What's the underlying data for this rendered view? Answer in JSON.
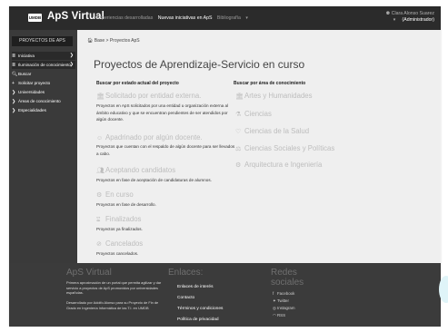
{
  "nav": {
    "logo_text": "UMDB",
    "brand": "ApS Virtual",
    "links": [
      "Experiencias desarrolladas",
      "Nuevas iniciativas en ApS",
      "Bibliografía"
    ],
    "dropdown_caret": "▾",
    "user_name": "Clara Alonso Suarez",
    "user_role": "(Administrador)",
    "user_caret": "▾"
  },
  "sidebar": {
    "title": "PROYECTOS DE APS",
    "items": [
      {
        "icon": "≣",
        "label": "Iniciativa",
        "chevron": "❯"
      },
      {
        "icon": "≣",
        "label": "Iluminación de conocimiento",
        "chevron": "❯"
      },
      {
        "icon": "🔍︎",
        "label": "Buscar",
        "chevron": ""
      },
      {
        "icon": "+",
        "label": "Solicitar proyecto",
        "chevron": ""
      },
      {
        "icon": "❯",
        "label": "Universidades",
        "chevron": ""
      },
      {
        "icon": "❯",
        "label": "Áreas de conocimiento",
        "chevron": ""
      },
      {
        "icon": "❯",
        "label": "Especialidades",
        "chevron": ""
      }
    ]
  },
  "main": {
    "breadcrumb": "🏠︎ Base > Proyectos ApS",
    "title": "Proyectos de Aprendizaje-Servicio en curso",
    "left_header": "Buscar por estado actual del proyecto",
    "right_header": "Buscar por área de conocimiento",
    "states": [
      {
        "icon": "🏛︎",
        "label": "Solicitado por entidad externa.",
        "desc": "Proyectos en ApS solicitados por una entidad u organización externa al ámbito educativo y que se encuentran pendientes de ser atendidos por algún docente."
      },
      {
        "icon": "☺︎",
        "label": "Apadrinado por algún docente.",
        "desc": "Proyectos que cuentan con el respaldo de algún docente para ser llevados a cabo."
      },
      {
        "icon": "👥︎",
        "label": "Aceptando candidatos",
        "desc": "Proyectos en fase de aceptación de candidaturas de alumnos."
      },
      {
        "icon": "⚙︎",
        "label": "En curso",
        "desc": "Proyectos en fase de desarrollo."
      },
      {
        "icon": "⌛︎",
        "label": "Finalizados",
        "desc": "Proyectos ya finalizados."
      },
      {
        "icon": "⊘",
        "label": "Cancelados",
        "desc": "Proyectos cancelados."
      }
    ],
    "areas": [
      {
        "icon": "🏛︎",
        "label": "Artes y Humanidades"
      },
      {
        "icon": "⚗︎",
        "label": "Ciencias"
      },
      {
        "icon": "♡︎",
        "label": "Ciencias de la Salud"
      },
      {
        "icon": "⚖︎",
        "label": "Ciencias Sociales y Políticas"
      },
      {
        "icon": "⚙︎",
        "label": "Arquitectura e Ingeniería"
      }
    ]
  },
  "footer": {
    "col1_title": "ApS Virtual",
    "col1_text1": "Primera aproximación de un portal que permita agilizar y dar servicio a proyectos de ApS promovidos por universidades españolas.",
    "col1_text2": "Desarrollado por Adolfo Alonso para su Proyecto de Fin de Grado en Ingeniería Informática de las T.I. en UMDB",
    "col2_title": "Enlaces:",
    "links": [
      "Enlaces de interés",
      "Contacto",
      "Términos y condiciones",
      "Política de privacidad"
    ],
    "col3_title": "Redes sociales",
    "social": [
      {
        "icon": "f",
        "label": "Facebook"
      },
      {
        "icon": "✦",
        "label": "Twitter"
      },
      {
        "icon": "◎",
        "label": "Instagram"
      },
      {
        "icon": "◠",
        "label": "RSS"
      }
    ]
  }
}
